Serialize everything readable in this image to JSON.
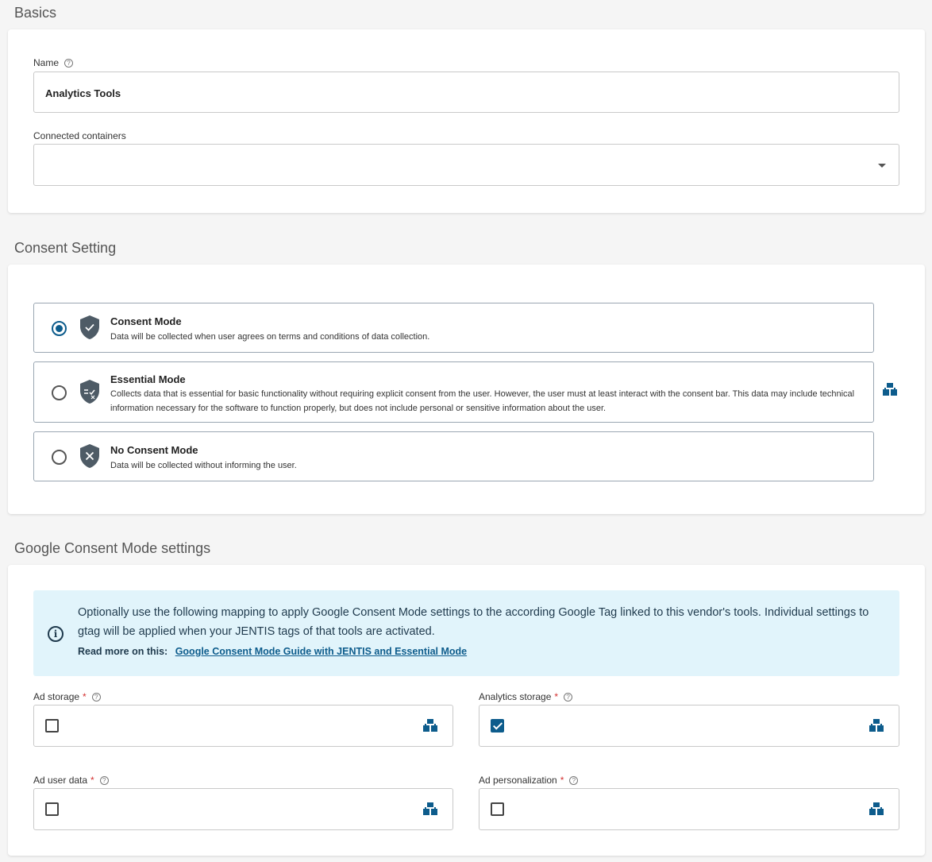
{
  "basics": {
    "section_title": "Basics",
    "name_label": "Name",
    "name_value": "Analytics Tools",
    "containers_label": "Connected containers",
    "containers_value": ""
  },
  "consent": {
    "section_title": "Consent Setting",
    "options": [
      {
        "title": "Consent Mode",
        "description": "Data will be collected when user agrees on terms and conditions of data collection.",
        "selected": true,
        "icon": "shield-check-icon"
      },
      {
        "title": "Essential Mode",
        "description": "Collects data that is essential for basic functionality without requiring explicit consent from the user. However, the user must at least interact with the consent bar. This data may include technical information necessary for the software to function properly, but does not include personal or sensitive information about the user.",
        "selected": false,
        "icon": "shield-equal-check-icon"
      },
      {
        "title": "No Consent Mode",
        "description": "Data will be collected without informing the user.",
        "selected": false,
        "icon": "shield-x-icon"
      }
    ]
  },
  "google": {
    "section_title": "Google Consent Mode settings",
    "info_text": "Optionally use the following mapping to apply Google Consent Mode settings to the according Google Tag linked to this vendor's tools. Individual settings to gtag will be applied when your JENTIS tags of that tools are activated.",
    "read_more_label": "Read more on this:",
    "read_more_link": "Google Consent Mode Guide with JENTIS and Essential Mode",
    "fields": {
      "ad_storage": {
        "label": "Ad storage",
        "required_mark": "*",
        "checked": false
      },
      "analytics_storage": {
        "label": "Analytics storage",
        "required_mark": "*",
        "checked": true
      },
      "ad_user_data": {
        "label": "Ad user data",
        "required_mark": "*",
        "checked": false
      },
      "ad_personalization": {
        "label": "Ad personalization",
        "required_mark": "*",
        "checked": false
      }
    }
  },
  "icons": {
    "help": "question-circle-icon",
    "info": "info-circle-icon",
    "stack": "stack-blocks-icon",
    "dropdown": "chevron-down-icon"
  },
  "colors": {
    "accent": "#0d5c8c",
    "info_background": "#e1f4fb",
    "required": "#d32f2f"
  }
}
